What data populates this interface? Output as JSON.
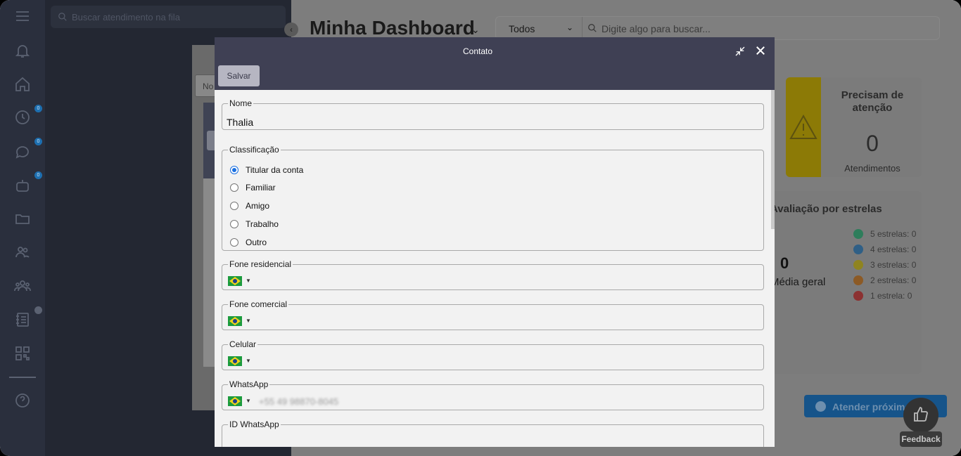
{
  "queue": {
    "search_placeholder": "Buscar atendimento na fila"
  },
  "rail": {
    "badges": [
      "0",
      "0",
      "0"
    ]
  },
  "dashboard": {
    "title": "Minha Dashboard",
    "filter_selected": "Todos",
    "search_placeholder": "Digite algo para buscar...",
    "attention": {
      "title": "Precisam de atenção",
      "value": "0",
      "label": "Atendimentos"
    },
    "stars": {
      "title": "Avaliação por estrelas",
      "avg_value": "0",
      "avg_label": "Média geral",
      "legend": [
        {
          "label": "5 estrelas: 0",
          "color": "#2e7d5b"
        },
        {
          "label": "4 estrelas: 0",
          "color": "#2f5f86"
        },
        {
          "label": "3 estrelas: 0",
          "color": "#8f8420"
        },
        {
          "label": "2 estrelas: 0",
          "color": "#8c5a25"
        },
        {
          "label": "1 estrela: 0",
          "color": "#8c3131"
        }
      ]
    },
    "next_button": "Atender próximo",
    "feedback_label": "Feedback"
  },
  "bg_window": {
    "field_prefix": "No"
  },
  "modal": {
    "title": "Contato",
    "save_label": "Salvar",
    "fields": {
      "nome_label": "Nome",
      "nome_value": "Thalia",
      "classificacao_label": "Classificação",
      "classificacao_options": [
        "Titular da conta",
        "Familiar",
        "Amigo",
        "Trabalho",
        "Outro"
      ],
      "fone_residencial_label": "Fone residencial",
      "fone_comercial_label": "Fone comercial",
      "celular_label": "Celular",
      "whatsapp_label": "WhatsApp",
      "whatsapp_value": "+55 49 98870-8045",
      "id_whatsapp_label": "ID WhatsApp"
    }
  }
}
